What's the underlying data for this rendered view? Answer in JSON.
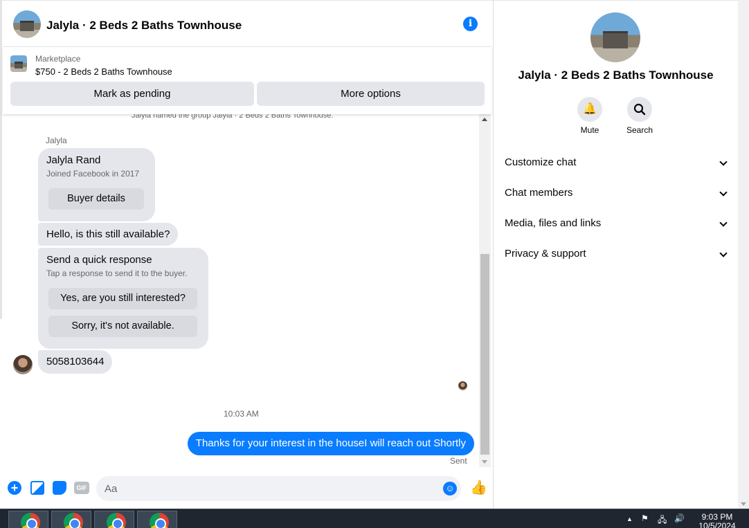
{
  "header": {
    "title": "Jalyla · 2 Beds 2 Baths Townhouse",
    "avatar_icon": "house-photo",
    "info_icon": "info-icon"
  },
  "marketplace": {
    "label": "Marketplace",
    "listing": "$750 - 2 Beds 2 Baths Townhouse",
    "mark_pending": "Mark as pending",
    "more_options": "More options"
  },
  "messages": {
    "system_note": "Jalyla named the group Jalyla · 2 Beds 2 Baths Townhouse.",
    "sender_name": "Jalyla",
    "profile_card": {
      "name": "Jalyla Rand",
      "joined": "Joined Facebook in 2017",
      "button": "Buyer details"
    },
    "hello": "Hello, is this still available?",
    "quick_response": {
      "title": "Send a quick response",
      "subtitle": "Tap a response to send it to the buyer.",
      "option1": "Yes, are you still interested?",
      "option2": "Sorry, it's not available."
    },
    "phone": "5058103644",
    "timestamp": "10:03 AM",
    "outgoing": "Thanks for your interest in the houseI will reach out Shortly",
    "status": "Sent"
  },
  "composer": {
    "placeholder": "Aa",
    "icons": [
      "plus-icon",
      "photo-icon",
      "sticker-icon",
      "gif-icon",
      "emoji-icon",
      "thumbs-up-icon"
    ],
    "gif_label": "GIF"
  },
  "details": {
    "title": "Jalyla · 2 Beds 2 Baths Townhouse",
    "actions": [
      {
        "label": "Mute",
        "icon": "bell-icon"
      },
      {
        "label": "Search",
        "icon": "search-icon"
      }
    ],
    "sections": [
      "Customize chat",
      "Chat members",
      "Media, files and links",
      "Privacy & support"
    ]
  },
  "taskbar": {
    "time": "9:03 PM",
    "date": "10/5/2024",
    "apps": [
      "chrome-icon",
      "chrome-icon",
      "chrome-icon",
      "chrome-icon"
    ]
  },
  "colors": {
    "accent": "#0a7cff",
    "bubble_gray": "#e4e6eb",
    "taskbar": "#1f2630"
  }
}
